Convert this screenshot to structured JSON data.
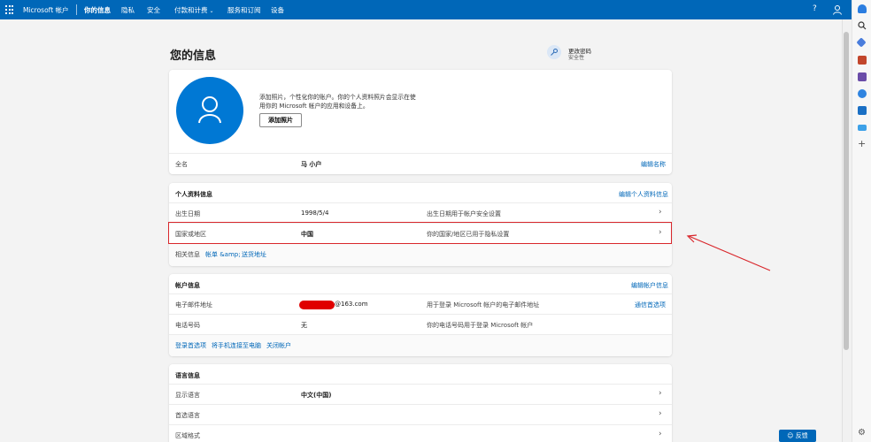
{
  "topbar": {
    "brand": "Microsoft 帐户",
    "nav": [
      "你的信息",
      "隐私",
      "安全",
      "付款和计费",
      "服务和订阅",
      "设备"
    ],
    "help": "?"
  },
  "page": {
    "title": "您的信息",
    "password_change": {
      "title": "更改密码",
      "subtitle": "安全性"
    }
  },
  "profile_card": {
    "photo_text_line1": "添加照片，个性化你的账户。你的个人资料照片会显示在使",
    "photo_text_line2": "用你的 Microsoft 帐户的应用和设备上。",
    "add_photo": "添加照片",
    "fullname_label": "全名",
    "fullname_value": "马 小户",
    "edit_name": "编辑名称"
  },
  "personal_card": {
    "heading": "个人资料信息",
    "edit_link": "编辑个人资料信息",
    "rows": [
      {
        "label": "出生日期",
        "value": "1998/5/4",
        "desc": "出生日期用于帐户安全设置"
      },
      {
        "label": "国家或地区",
        "value": "中国",
        "desc": "你的国家/地区已用于隐私设置"
      }
    ],
    "related_label": "相关信息",
    "related_links": [
      "帐单 &amp;",
      "送货地址"
    ]
  },
  "account_card": {
    "heading": "帐户信息",
    "edit_link": "编辑帐户信息",
    "rows": [
      {
        "label": "电子邮件地址",
        "value": "@163.com",
        "desc": "用于登录 Microsoft 帐户的电子邮件地址",
        "action": "通信首选项"
      },
      {
        "label": "电话号码",
        "value": "无",
        "desc": "你的电话号码用于登录 Microsoft 帐户"
      }
    ],
    "footer_links": [
      "登录首选项",
      "将手机连接至电脑",
      "关闭帐户"
    ]
  },
  "language_card": {
    "heading": "语言信息",
    "rows": [
      {
        "label": "显示语言",
        "value": "中文(中国)"
      },
      {
        "label": "首选语言",
        "value": ""
      },
      {
        "label": "区域格式",
        "value": ""
      }
    ]
  },
  "feedback": "反馈",
  "colors": {
    "brand_blue": "#0067b8",
    "accent_blue": "#0078d4",
    "highlight_red": "#d9262b"
  }
}
